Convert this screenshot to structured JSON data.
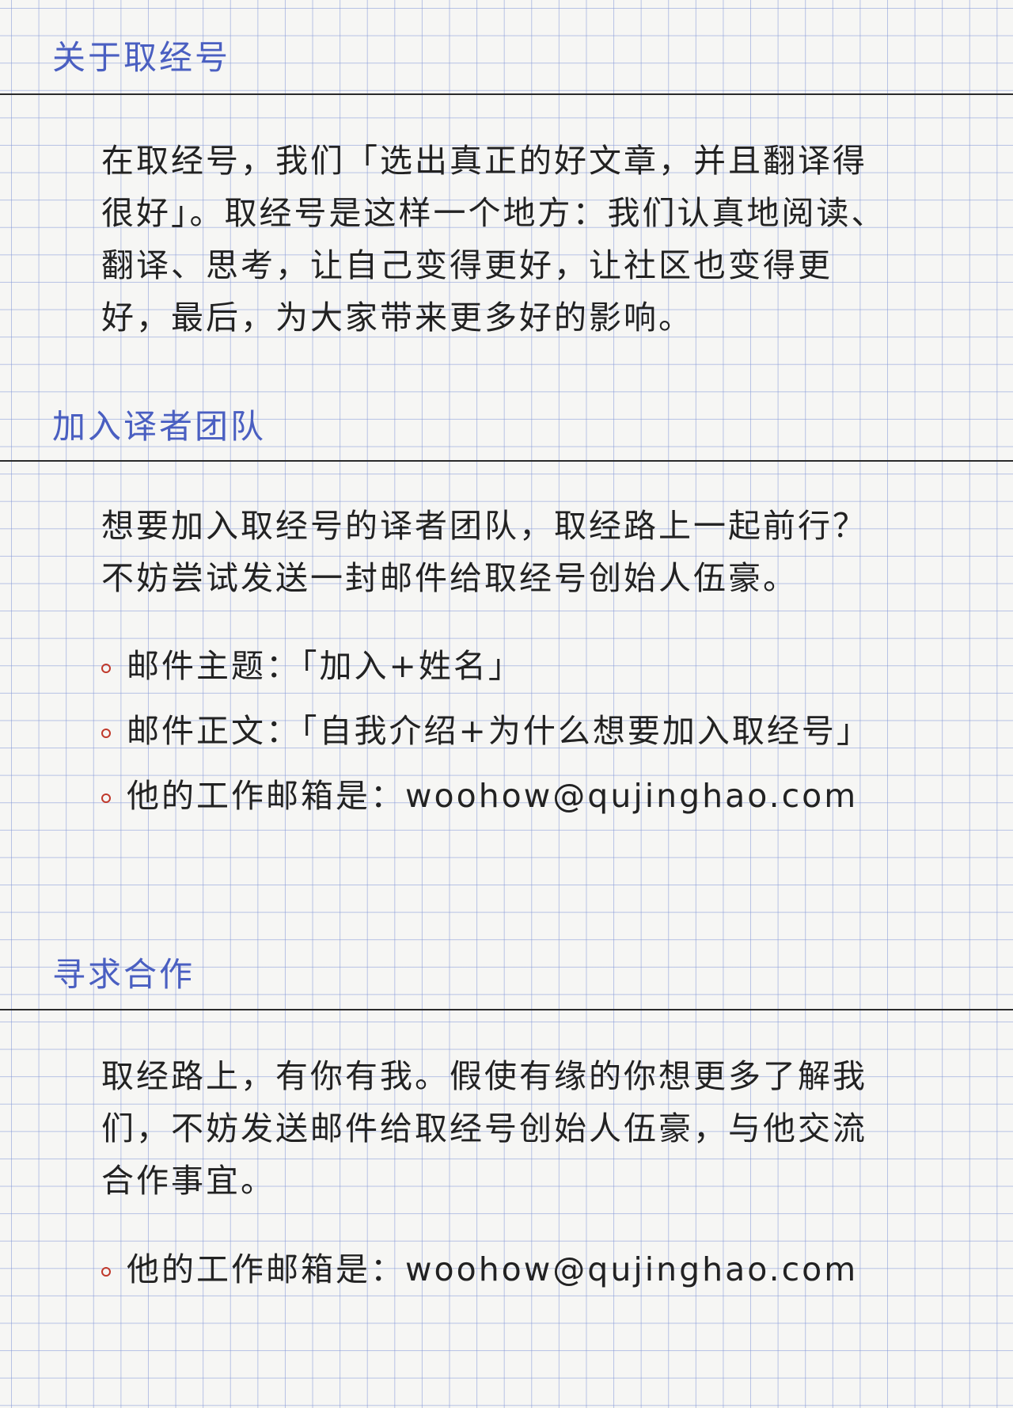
{
  "sections": [
    {
      "title": "关于取经号",
      "paragraphs": [
        "在取经号，我们「选出真正的好文章，并且翻译得很好」。取经号是这样一个地方：我们认真地阅读、翻译、思考，让自己变得更好，让社区也变得更好，最后，为大家带来更多好的影响。"
      ]
    },
    {
      "title": "加入译者团队",
      "paragraphs": [
        "想要加入取经号的译者团队，取经路上一起前行？不妨尝试发送一封邮件给取经号创始人伍豪。"
      ],
      "bullets": [
        "邮件主题：「加入+姓名」",
        "邮件正文：「自我介绍+为什么想要加入取经号」",
        "他的工作邮箱是：woohow@qujinghao.com"
      ]
    },
    {
      "title": "寻求合作",
      "paragraphs": [
        "取经路上，有你有我。假使有缘的你想更多了解我们，不妨发送邮件给取经号创始人伍豪，与他交流合作事宜。"
      ],
      "bullets": [
        "他的工作邮箱是：woohow@qujinghao.com"
      ]
    }
  ],
  "colors": {
    "heading": "#4a5fc1",
    "text": "#222222",
    "bullet": "#c0392b",
    "grid": "#8296d7",
    "paper": "#f6f6f4"
  }
}
